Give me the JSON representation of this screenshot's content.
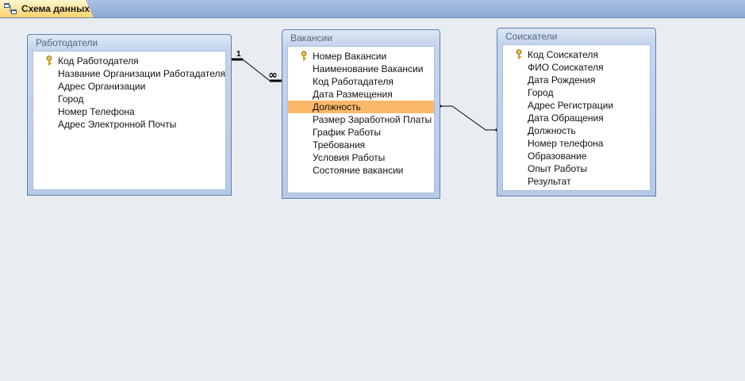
{
  "tab": {
    "label": "Схема данных"
  },
  "tables": {
    "employers": {
      "title": "Работодатели",
      "fields": [
        "Код Работодателя",
        "Название Организации Работадателя",
        "Адрес Организации",
        "Город",
        "Номер Телефона",
        "Адрес Электронной Почты"
      ]
    },
    "vacancies": {
      "title": "Вакансии",
      "fields": [
        "Номер Вакансии",
        "Наименование Вакансии",
        "Код Работадателя",
        "Дата Размещения",
        "Должность",
        "Размер Заработной Платы",
        "График Работы",
        "Требования",
        "Условия Работы",
        "Состояние вакансии"
      ]
    },
    "applicants": {
      "title": "Соискатели",
      "fields": [
        "Код Соискателя",
        "ФИО Соискателя",
        "Дата Рождения",
        "Город",
        "Адрес Регистрации",
        "Дата Обращения",
        "Должность",
        "Номер телефона",
        "Образование",
        "Опыт Работы",
        "Результат"
      ]
    }
  },
  "relations": {
    "one_label": "1",
    "many_label": "∞"
  },
  "colors": {
    "highlight": "#fbb868",
    "tab": "#ffd36b",
    "border": "#5c7fae"
  }
}
